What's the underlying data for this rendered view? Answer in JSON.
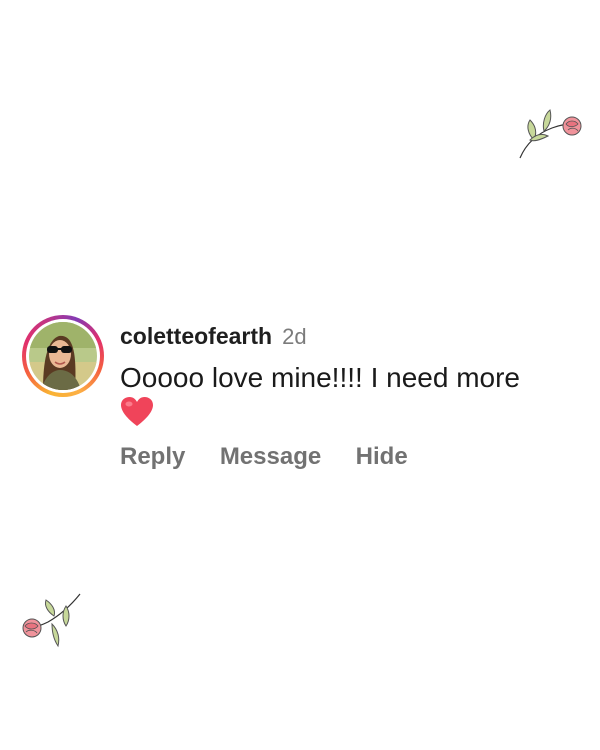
{
  "comment": {
    "username": "coletteofearth",
    "timestamp": "2d",
    "text": "Ooooo love mine!!!! I need more",
    "emoji_icon": "red-heart-icon"
  },
  "actions": {
    "reply_label": "Reply",
    "message_label": "Message",
    "hide_label": "Hide"
  },
  "colors": {
    "username": "#1f1f1f",
    "timestamp": "#7b7b7b",
    "action_text": "#727272",
    "heart": "#f0445a",
    "story_ring": [
      "#f9b233",
      "#e1306c",
      "#833ab4"
    ],
    "flower_petal": "#f0939b",
    "flower_leaf": "#c7d89a"
  },
  "decorations": {
    "flower_icons": [
      "rose-branch-icon",
      "rose-branch-icon"
    ]
  }
}
